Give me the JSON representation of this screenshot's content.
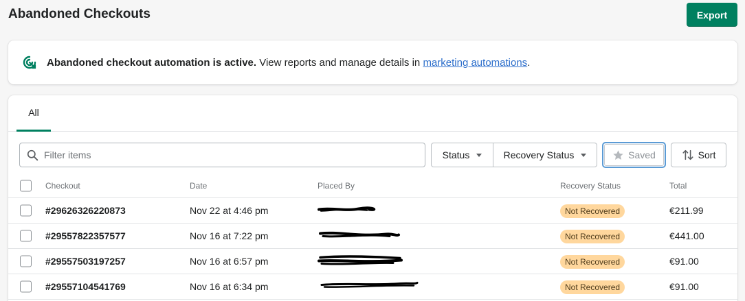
{
  "page": {
    "title": "Abandoned Checkouts"
  },
  "actions": {
    "export_label": "Export"
  },
  "banner": {
    "strong": "Abandoned checkout automation is active.",
    "text": " View reports and manage details in ",
    "link": "marketing automations",
    "end": "."
  },
  "tabs": [
    {
      "label": "All",
      "selected": true
    }
  ],
  "filters": {
    "search_placeholder": "Filter items",
    "status_label": "Status",
    "recovery_label": "Recovery Status",
    "saved_label": "Saved",
    "sort_label": "Sort"
  },
  "table": {
    "headers": {
      "checkout": "Checkout",
      "date": "Date",
      "placed_by": "Placed By",
      "recovery_status": "Recovery Status",
      "total": "Total"
    },
    "rows": [
      {
        "checkout": "#29626326220873",
        "date": "Nov 22 at 4:46 pm",
        "status": "Not Recovered",
        "total": "€211.99"
      },
      {
        "checkout": "#29557822357577",
        "date": "Nov 16 at 7:22 pm",
        "status": "Not Recovered",
        "total": "€441.00"
      },
      {
        "checkout": "#29557503197257",
        "date": "Nov 16 at 6:57 pm",
        "status": "Not Recovered",
        "total": "€91.00"
      },
      {
        "checkout": "#29557104541769",
        "date": "Nov 16 at 6:34 pm",
        "status": "Not Recovered",
        "total": "€91.00"
      }
    ]
  },
  "colors": {
    "primary": "#008060",
    "badge_bg": "#ffd79d",
    "link": "#2c6ecb"
  },
  "icons": {
    "banner": "automation-target-icon",
    "search": "search-icon",
    "saved": "star-icon",
    "sort": "sort-arrows-icon"
  }
}
